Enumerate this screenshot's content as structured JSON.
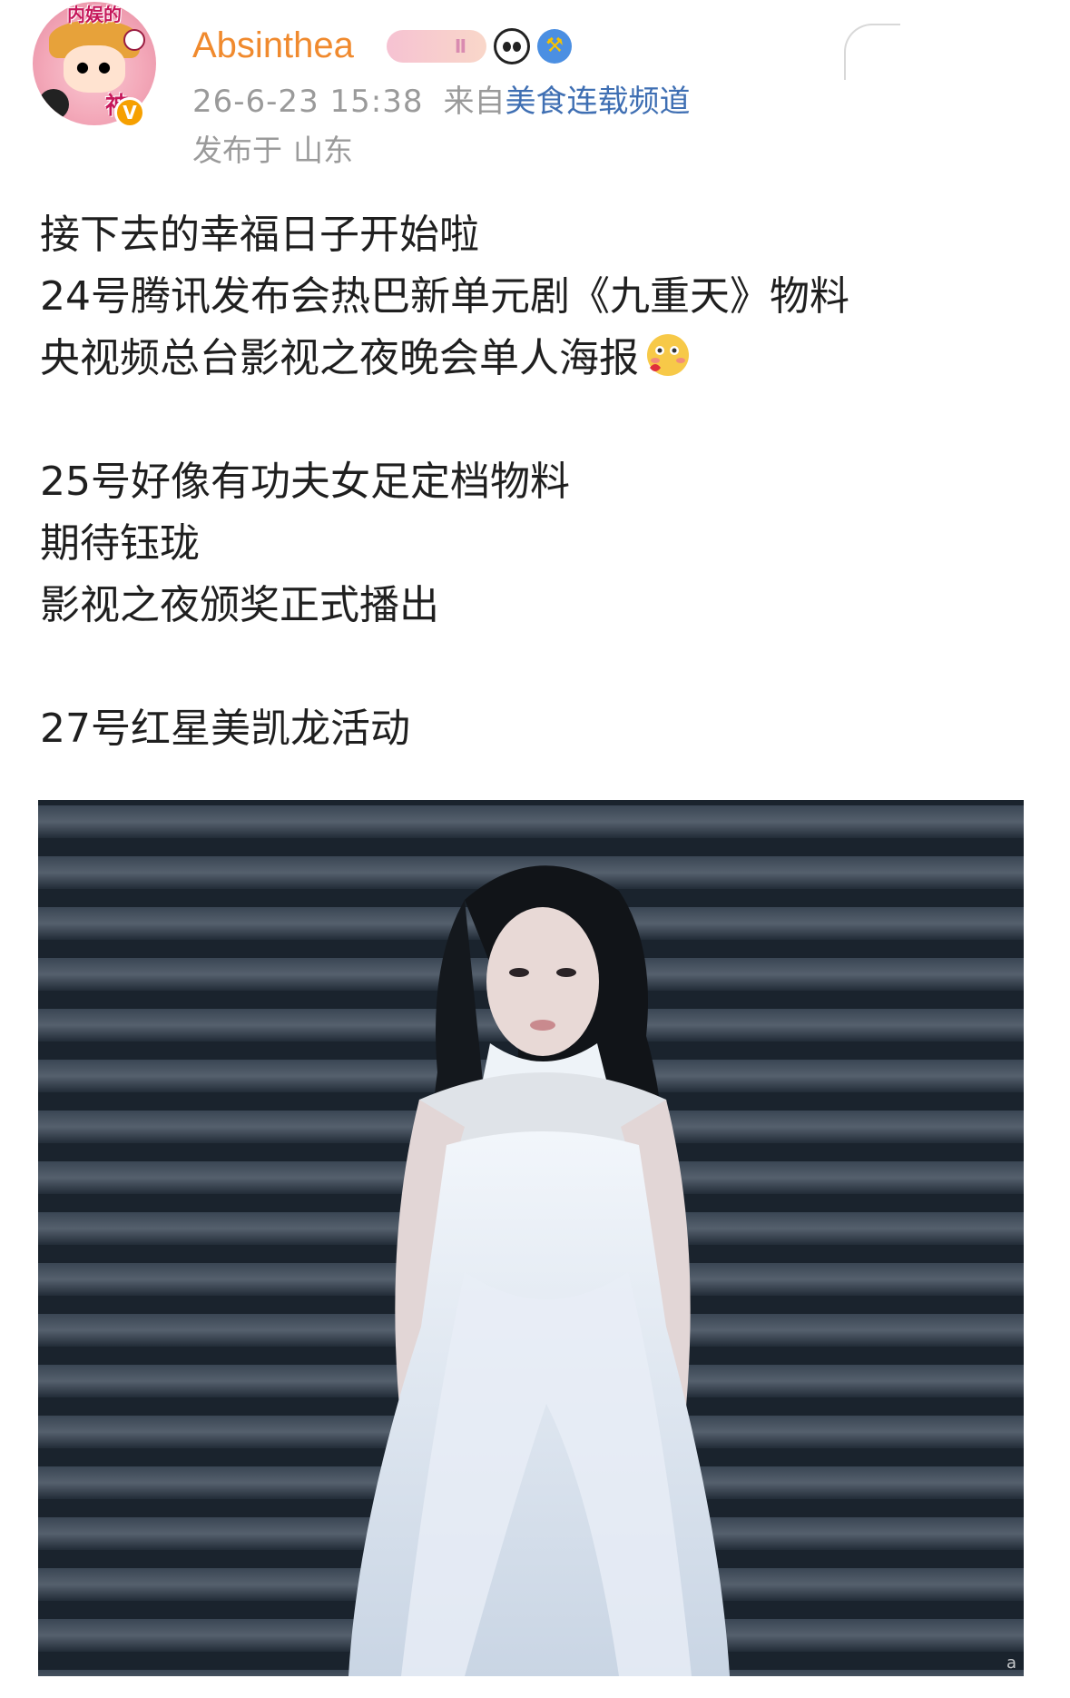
{
  "post": {
    "author": {
      "name": "Absinthea",
      "avatar_text_top": "内娱的",
      "avatar_text_bottom": "神",
      "verified_badge": "V",
      "badge_pill_text": "Ⅱ",
      "icons": [
        "verified-badge-icon",
        "level-badge-icon",
        "panda-icon",
        "hammer-shield-icon"
      ]
    },
    "time": "26-6-23 15:38",
    "source_prefix": "来自",
    "source_name": "美食连载频道",
    "location_label": "发布于",
    "location_value": "山东",
    "content_lines": [
      "接下去的幸福日子开始啦",
      "24号腾讯发布会热巴新单元剧《九重天》物料",
      "央视频总台影视之夜晚会单人海报",
      "",
      "25号好像有功夫女足定档物料",
      "期待钰珑",
      "影视之夜颁奖正式播出",
      "",
      "27号红星美凯龙活动"
    ],
    "inline_emoji": "blush-emoji-icon",
    "image": {
      "description_icon": "photo-woman-white-dress",
      "watermark": "a"
    }
  },
  "colors": {
    "username": "#f08a2e",
    "meta": "#9a9a9a",
    "source_link": "#3f6fb3",
    "text": "#1f1f1f"
  }
}
